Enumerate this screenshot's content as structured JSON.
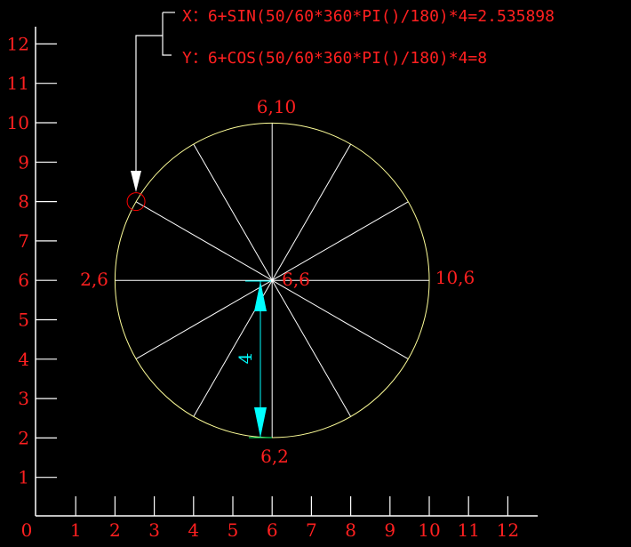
{
  "formulas": {
    "x": "X：6+SIN(50/60*360*PI()/180)*4=2.535898",
    "y": "Y：6+COS(50/60*360*PI()/180)*4=8"
  },
  "point_labels": {
    "top": "6,10",
    "left": "2,6",
    "center": "6,6",
    "right": "10,6",
    "bottom": "6,2"
  },
  "dimension_label": "4",
  "axis": {
    "x_ticks": [
      "0",
      "1",
      "2",
      "3",
      "4",
      "5",
      "6",
      "7",
      "8",
      "9",
      "10",
      "11",
      "12"
    ],
    "y_ticks": [
      "1",
      "2",
      "3",
      "4",
      "5",
      "6",
      "7",
      "8",
      "9",
      "10",
      "11",
      "12"
    ]
  },
  "diagram": {
    "center": [
      6,
      6
    ],
    "radius": 4,
    "spoke_count": 12,
    "marked_point": [
      2.535898,
      8
    ]
  },
  "colors": {
    "background": "#000000",
    "text": "#ff2020",
    "circle": "#ffff99",
    "spokes": "#ffffff",
    "dimension": "#00ffff",
    "axes": "#ffffff",
    "marker": "#ff0000"
  }
}
